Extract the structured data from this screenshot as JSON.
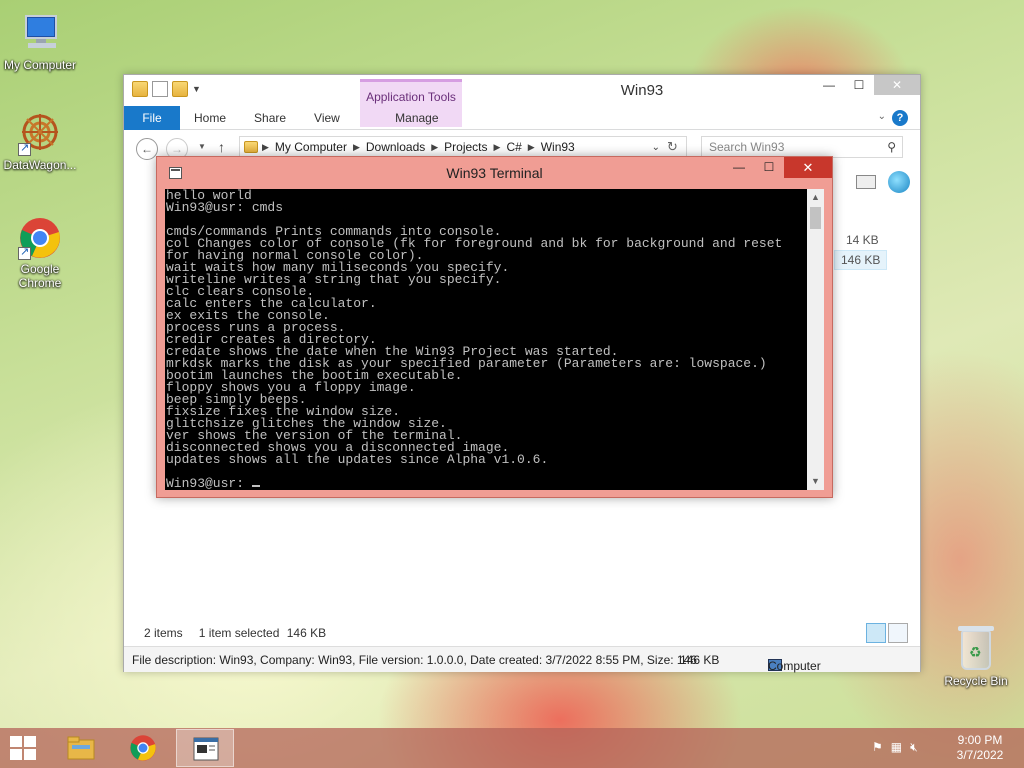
{
  "desktop": {
    "icons": [
      {
        "label": "My Computer",
        "icon": "computer-icon"
      },
      {
        "label": "DataWagon...",
        "icon": "datawagon-icon"
      },
      {
        "label": "Google Chrome",
        "icon": "chrome-icon"
      }
    ],
    "recycle_bin": {
      "label": "Recycle Bin",
      "icon": "recycle-bin-icon"
    }
  },
  "explorer": {
    "title": "Win93",
    "contextual_group": "Application Tools",
    "ribbon_tabs": {
      "file": "File",
      "home": "Home",
      "share": "Share",
      "view": "View",
      "manage": "Manage"
    },
    "address": [
      "My Computer",
      "Downloads",
      "Projects",
      "C#",
      "Win93"
    ],
    "search_placeholder": "Search Win93",
    "visible_sizes": [
      "14 KB",
      "146 KB"
    ],
    "status": {
      "items": "2 items",
      "selected": "1 item selected",
      "selected_size": "146 KB"
    },
    "details": {
      "description": "File description: Win93, Company: Win93, File version: 1.0.0.0, Date created: 3/7/2022 8:55 PM, Size: 146",
      "size": "146 KB",
      "location": "Computer"
    }
  },
  "terminal": {
    "title": "Win93 Terminal",
    "lines": [
      "hello world",
      "Win93@usr: cmds",
      "",
      "cmds/commands Prints commands into console.",
      "col Changes color of console (fk for foreground and bk for background and reset",
      "for having normal console color).",
      "wait waits how many miliseconds you specify.",
      "writeline writes a string that you specify.",
      "clc clears console.",
      "calc enters the calculator.",
      "ex exits the console.",
      "process runs a process.",
      "credir creates a directory.",
      "credate shows the date when the Win93 Project was started.",
      "mrkdsk marks the disk as your specified parameter (Parameters are: lowspace.)",
      "bootim launches the bootim executable.",
      "floppy shows you a floppy image.",
      "beep simply beeps.",
      "fixsize fixes the window size.",
      "glitchsize glitches the window size.",
      "ver shows the version of the terminal.",
      "disconnected shows you a disconnected image.",
      "updates shows all the updates since Alpha v1.0.6.",
      ""
    ],
    "prompt": "Win93@usr: "
  },
  "taskbar": {
    "apps": [
      {
        "name": "File Explorer",
        "icon": "file-explorer-icon"
      },
      {
        "name": "Google Chrome",
        "icon": "chrome-icon"
      },
      {
        "name": "Win93 Terminal",
        "icon": "terminal-icon"
      }
    ],
    "time": "9:00 PM",
    "date": "3/7/2022"
  }
}
